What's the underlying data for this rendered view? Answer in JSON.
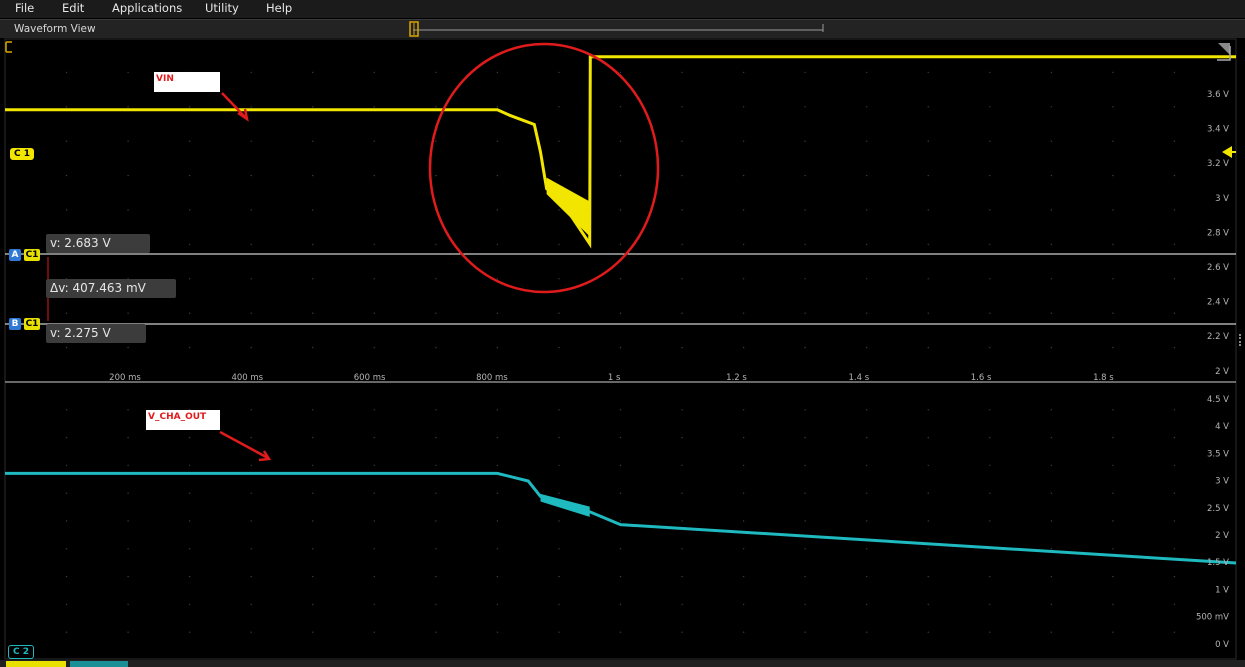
{
  "menu": [
    "File",
    "Edit",
    "Applications",
    "Utility",
    "Help"
  ],
  "window": {
    "title": "Waveform View"
  },
  "x_ticks": [
    "200 ms",
    "400 ms",
    "600 ms",
    "800 ms",
    "1 s",
    "1.2 s",
    "1.4 s",
    "1.6 s",
    "1.8 s"
  ],
  "upper_y_ticks": [
    "3.6 V",
    "3.4 V",
    "3.2 V",
    "3 V",
    "2.8 V",
    "2.6 V",
    "2.4 V",
    "2.2 V",
    "2 V"
  ],
  "lower_y_ticks": [
    "4.5 V",
    "4 V",
    "3.5 V",
    "3 V",
    "2.5 V",
    "2 V",
    "1.5 V",
    "1 V",
    "500 mV",
    "0 V"
  ],
  "channels": {
    "c1_label": "C 1",
    "c2_label": "C 2",
    "c1_color": "#f2e600",
    "c2_color": "#1fb9c0"
  },
  "cursors": {
    "a_badge": "A",
    "b_badge": "B",
    "channel_badge": "C1",
    "a_value": "v: 2.683 V",
    "delta": "Δv: 407.463 mV",
    "b_value": "v: 2.275 V"
  },
  "annotations": {
    "vin": "VIN",
    "vout": "V_CHA_OUT",
    "highlight_color": "#e01b1b"
  },
  "chart_data": [
    {
      "type": "line",
      "title": "",
      "series": [
        {
          "name": "VIN",
          "x": [
            0,
            0.8,
            0.82,
            0.86,
            0.87,
            0.88,
            0.9,
            0.93,
            0.95,
            0.951,
            2.0
          ],
          "y": [
            3.43,
            3.43,
            3.4,
            3.35,
            3.2,
            3.0,
            2.95,
            2.8,
            2.7,
            3.72,
            3.72
          ]
        }
      ],
      "xlim": [
        0,
        2.0
      ],
      "ylim": [
        2.0,
        3.8
      ],
      "xlabel": "",
      "ylabel": "",
      "cursor_a": 2.683,
      "cursor_b": 2.275
    },
    {
      "type": "line",
      "title": "",
      "series": [
        {
          "name": "V_CHA_OUT",
          "x": [
            0,
            0.8,
            0.85,
            0.87,
            0.95,
            1.0,
            2.0
          ],
          "y": [
            3.45,
            3.45,
            3.3,
            3.0,
            2.7,
            2.45,
            1.7
          ]
        }
      ],
      "xlim": [
        0,
        2.0
      ],
      "ylim": [
        0,
        5.0
      ],
      "xlabel": "",
      "ylabel": ""
    }
  ]
}
